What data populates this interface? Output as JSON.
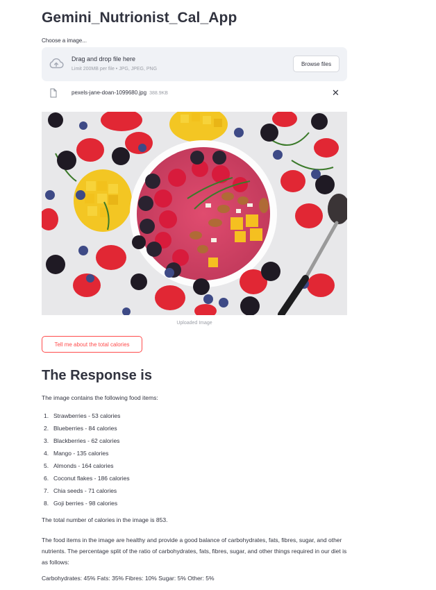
{
  "app": {
    "title": "Gemini_Nutrionist_Cal_App"
  },
  "uploader": {
    "label": "Choose a image...",
    "drop_text": "Drag and drop file here",
    "limit_text": "Limit 200MB per file • JPG, JPEG, PNG",
    "browse_label": "Browse files",
    "upload_icon": "cloud-upload-icon"
  },
  "file": {
    "name": "pexels-jane-doan-1099680.jpg",
    "size": "388.9KB",
    "icon": "file-icon",
    "remove_icon": "close-icon"
  },
  "image": {
    "caption": "Uploaded Image"
  },
  "action": {
    "label": "Tell me about the total calories"
  },
  "response": {
    "heading": "The Response is",
    "intro": "The image contains the following food items:",
    "items": [
      {
        "num": "1.",
        "text": "Strawberries - 53 calories"
      },
      {
        "num": "2.",
        "text": "Blueberries - 84 calories"
      },
      {
        "num": "3.",
        "text": "Blackberries - 62 calories"
      },
      {
        "num": "4.",
        "text": "Mango - 135 calories"
      },
      {
        "num": "5.",
        "text": "Almonds - 164 calories"
      },
      {
        "num": "6.",
        "text": "Coconut flakes - 186 calories"
      },
      {
        "num": "7.",
        "text": "Chia seeds - 71 calories"
      },
      {
        "num": "8.",
        "text": "Goji berries - 98 calories"
      }
    ],
    "total": "The total number of calories in the image is 853.",
    "description": "The food items in the image are healthy and provide a good balance of carbohydrates, fats, fibres, sugar, and other nutrients. The percentage split of the ratio of carbohydrates, fats, fibres, sugar, and other things required in our diet is as follows:",
    "split": "Carbohydrates: 45% Fats: 35% Fibres: 10% Sugar: 5% Other: 5%"
  },
  "colors": {
    "accent": "#ff4b4b",
    "text": "#31333f",
    "muted": "#9b9ea6",
    "dropzone_bg": "#f0f2f6"
  }
}
